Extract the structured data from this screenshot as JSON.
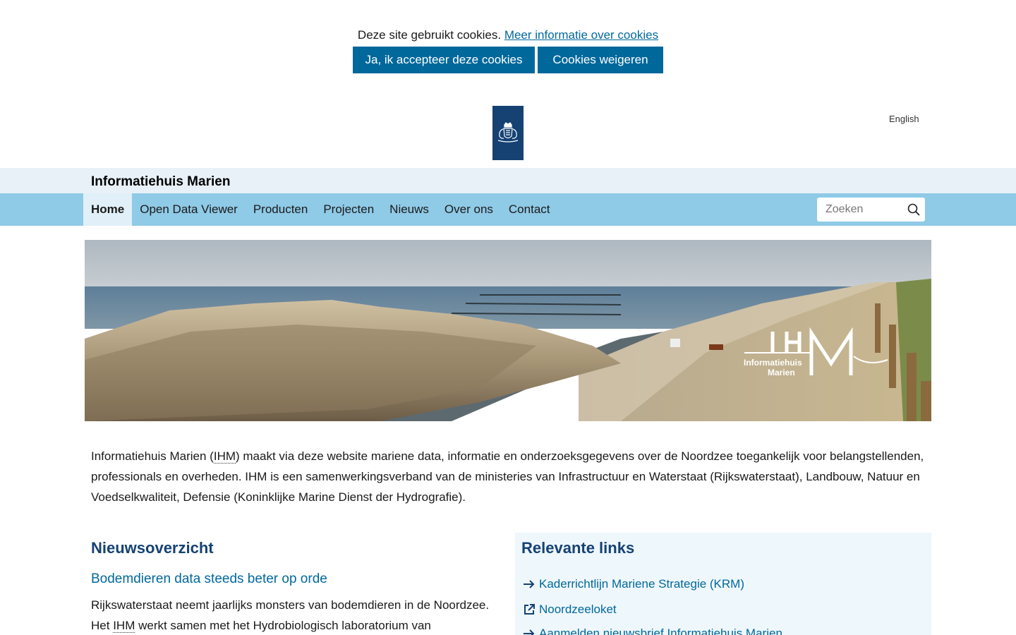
{
  "cookie": {
    "text": "Deze site gebruikt cookies.",
    "more_link": "Meer informatie over cookies",
    "accept_label": "Ja, ik accepteer deze cookies",
    "refuse_label": "Cookies weigeren"
  },
  "header": {
    "language_link": "English",
    "site_title": "Informatiehuis Marien",
    "logo_icon": "rijksoverheid-crest-icon"
  },
  "nav": {
    "items": [
      {
        "label": "Home",
        "active": true
      },
      {
        "label": "Open Data Viewer"
      },
      {
        "label": "Producten"
      },
      {
        "label": "Projecten"
      },
      {
        "label": "Nieuws"
      },
      {
        "label": "Over ons"
      },
      {
        "label": "Contact"
      }
    ],
    "search_placeholder": "Zoeken",
    "search_icon": "magnifier-icon"
  },
  "hero": {
    "logo_letters": "IHM",
    "logo_line1": "Informatiehuis",
    "logo_line2": "Marien"
  },
  "intro": {
    "part1": "Informatiehuis Marien (",
    "abbr": "IHM",
    "part2": ") maakt via deze website mariene data, informatie en onderzoeksgegevens over de Noordzee toegankelijk voor belangstellenden, professionals en overheden.  IHM is een samenwerkingsverband van de ministeries van Infrastructuur en Waterstaat (Rijkswaterstaat), Landbouw, Natuur en Voedselkwaliteit, Defensie (Koninklijke Marine Dienst der Hydrografie)."
  },
  "news": {
    "heading": "Nieuwsoverzicht",
    "item_title": "Bodemdieren data steeds beter op orde",
    "item_text_part1": "Rijkswaterstaat neemt jaarlijks monsters van bodemdieren in de Noordzee. Het ",
    "item_text_abbr": "IHM",
    "item_text_part2": " werkt samen met het Hydrobiologisch laboratorium van"
  },
  "links": {
    "heading": "Relevante links",
    "items": [
      {
        "label": "Kaderrichtlijn Mariene Strategie (KRM)",
        "icon": "arrow-right-icon"
      },
      {
        "label": "Noordzeeloket",
        "icon": "external-link-icon"
      },
      {
        "label": "Aanmelden nieuwsbrief Informatiehuis Marien",
        "icon": "arrow-right-icon"
      }
    ]
  },
  "colors": {
    "primary": "#01689b",
    "dark_blue": "#154273",
    "nav_bg": "#8fcae7",
    "title_bar_bg": "#e8f1f8",
    "links_box_bg": "#eef7fc"
  }
}
